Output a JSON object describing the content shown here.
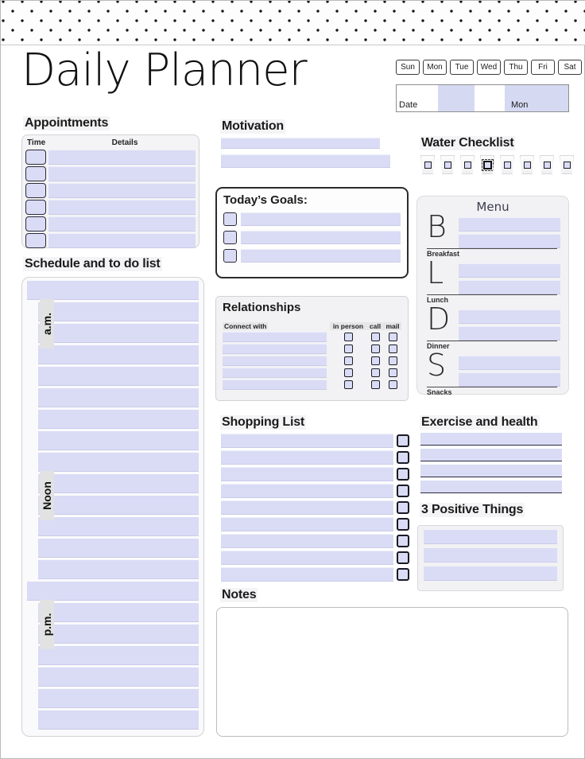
{
  "page": {
    "title": "Daily Planner"
  },
  "days": [
    "Sun",
    "Mon",
    "Tue",
    "Wed",
    "Thu",
    "Fri",
    "Sat"
  ],
  "date_bar": {
    "date_label": "Date",
    "day_value": "Mon"
  },
  "appointments": {
    "title": "Appointments",
    "col_time": "Time",
    "col_details": "Details",
    "rows": [
      {
        "time": "",
        "details": ""
      },
      {
        "time": "",
        "details": ""
      },
      {
        "time": "",
        "details": ""
      },
      {
        "time": "",
        "details": ""
      },
      {
        "time": "",
        "details": ""
      },
      {
        "time": "",
        "details": ""
      }
    ]
  },
  "schedule": {
    "title": "Schedule and to do list",
    "period_labels": [
      "a.m.",
      "Noon",
      "p.m."
    ],
    "row_count": 21,
    "rows": [
      "",
      "",
      "",
      "",
      "",
      "",
      "",
      "",
      "",
      "",
      "",
      "",
      "",
      "",
      "",
      "",
      "",
      "",
      "",
      "",
      ""
    ]
  },
  "motivation": {
    "title": "Motivation",
    "lines": [
      "",
      ""
    ]
  },
  "goals": {
    "title": "Today’s Goals:",
    "items": [
      "",
      "",
      ""
    ]
  },
  "relationships": {
    "title": "Relationships",
    "col_connect": "Connect with",
    "col_in_person": "in person",
    "col_call": "call",
    "col_mail": "mail",
    "rows": [
      {
        "name": "",
        "in_person": false,
        "call": false,
        "mail": false
      },
      {
        "name": "",
        "in_person": false,
        "call": false,
        "mail": false
      },
      {
        "name": "",
        "in_person": false,
        "call": false,
        "mail": false
      },
      {
        "name": "",
        "in_person": false,
        "call": false,
        "mail": false
      },
      {
        "name": "",
        "in_person": false,
        "call": false,
        "mail": false
      }
    ]
  },
  "shopping": {
    "title": "Shopping List",
    "items": [
      "",
      "",
      "",
      "",
      "",
      "",
      "",
      "",
      ""
    ]
  },
  "notes": {
    "title": "Notes",
    "content": ""
  },
  "water": {
    "title": "Water Checklist",
    "glass_count": 8,
    "focused_index": 3,
    "checked": [
      false,
      false,
      false,
      false,
      false,
      false,
      false,
      false
    ]
  },
  "menu": {
    "title": "Menu",
    "meals": [
      {
        "letter": "B",
        "name": "Breakfast",
        "lines": [
          "",
          ""
        ]
      },
      {
        "letter": "L",
        "name": "Lunch",
        "lines": [
          "",
          ""
        ]
      },
      {
        "letter": "D",
        "name": "Dinner",
        "lines": [
          "",
          ""
        ]
      },
      {
        "letter": "S",
        "name": "Snacks",
        "lines": [
          "",
          ""
        ]
      }
    ]
  },
  "exercise": {
    "title": "Exercise and health",
    "lines": [
      "",
      "",
      "",
      ""
    ]
  },
  "positive": {
    "title": "3 Positive Things",
    "items": [
      "",
      "",
      ""
    ]
  },
  "colors": {
    "field_fill": "#dadcf5",
    "panel_bg": "#f2f2f4",
    "ink": "#1a1a1a",
    "date_bar_fill": "#d6d9f2"
  }
}
